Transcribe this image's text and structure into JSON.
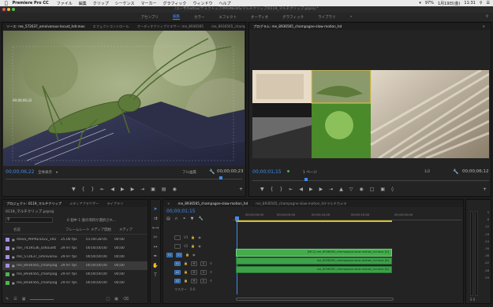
{
  "menubar": {
    "app": "Premiere Pro CC",
    "items": [
      "ファイル",
      "編集",
      "クリップ",
      "シーケンス",
      "マーカー",
      "グラフィック",
      "ウィンドウ",
      "ヘルプ"
    ],
    "battery": "97%",
    "date": "1月19日(金)",
    "time": "11:31"
  },
  "title_path": "/ユーザ/hattax/デスクトップ/PRONEWS/マルチクリップ/0119_マルチクリップ.prproj *",
  "workspaces": [
    "アセンブリ",
    "編集",
    "カラー",
    "エフェクト",
    "オーディオ",
    "グラフィック",
    "ライブラリ"
  ],
  "source": {
    "tabs": [
      "ソース: me_572637_omnivorous-locust_hdr.mov",
      "エフェクトコントロール",
      "オーディオクリップミキサー: me_8936565",
      "me_8936565_champagne-slow-motion_hd"
    ],
    "timecode_left": "00;00;06;22",
    "fit": "全体表示",
    "full": "フル画質",
    "timecode_right": "00;00;00;23",
    "overlay_tc": "00;00;06;22"
  },
  "program": {
    "tab": "プログラム: me_8936565_champagne-slow-motion_hd",
    "timecode_left": "00;00;01;15",
    "page": "1 ページ",
    "fraction": "1/2",
    "timecode_right": "00;00;06;12"
  },
  "project": {
    "tabs": [
      "プロジェクト: 0119_マルチクリップ",
      "メディアブラウザー",
      "ライブラリ"
    ],
    "name": "0119_マルチクリップ.prproj",
    "selected_info": "6 個中 1 個の項目が選択され...",
    "columns": [
      "名前",
      "フレームレート",
      "メディア開始",
      "メディア"
    ],
    "rows": [
      {
        "color": "#a58ee0",
        "name": "Alexa_PRPRE5422_192",
        "fps": "25.00 fps",
        "start": "01:00:28:05",
        "dur": "00:00"
      },
      {
        "color": "#a58ee0",
        "name": "me_7419536_silhouett",
        "fps": "29.97 fps",
        "start": "00;00;00;00",
        "dur": "00;00"
      },
      {
        "color": "#a58ee0",
        "name": "me_572637_omnivorou",
        "fps": "29.97 fps",
        "start": "00;00;00;00",
        "dur": "00;00"
      },
      {
        "color": "#a58ee0",
        "name": "me_8936565_champag",
        "fps": "29.97 fps",
        "start": "00;00;00;00",
        "dur": "00;00"
      },
      {
        "color": "#4fb24f",
        "name": "me_8936565_champag",
        "fps": "29.97 fps",
        "start": "00;00;00;00",
        "dur": "00;00"
      },
      {
        "color": "#4fb24f",
        "name": "me_8936565_champag",
        "fps": "29.97 fps",
        "start": "00;00;00;00",
        "dur": "00;00"
      }
    ]
  },
  "timeline": {
    "tab": "me_8936565_champagne-slow-motion_hd",
    "tab2": "me_8936565_champagne-slow-motion_hd-マルチカメラ",
    "timecode": "00;00;01;15",
    "ruler": [
      "00;00;00;00",
      "00;00;05;00",
      "00;00;10;00",
      "00;00;15;00",
      "00;00;20;00"
    ],
    "tracks": [
      "V3",
      "V2",
      "V1",
      "A1",
      "A2",
      "A3"
    ],
    "master": "マスター",
    "master_value": "0.0",
    "clips": [
      "[MC1] me_8936565_champagne-slow-motion_hd.mov [V]",
      "me_8936565_champagne-slow-motion_hd.mov [A]",
      "me_8936565_champagne-slow-motion_hd.mov [A]"
    ]
  },
  "meter": {
    "labels": [
      "0",
      "-6",
      "-12",
      "-18",
      "-24",
      "-30",
      "-36",
      "-42",
      "-48",
      "-54"
    ],
    "bottom": "S S"
  }
}
